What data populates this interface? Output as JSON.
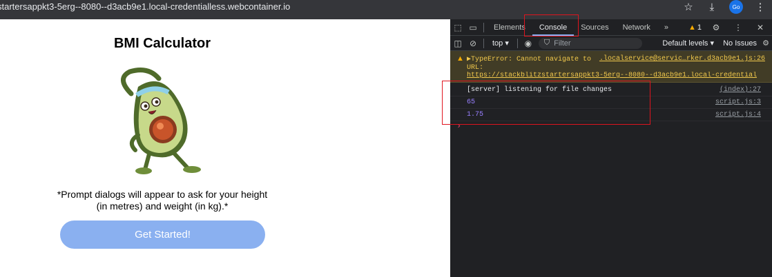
{
  "browser": {
    "url_prefix": "",
    "url": "startersappkt3-5erg--8080--d3acb9e1.local-credentialless.webcontainer.io",
    "icons": [
      "star-icon",
      "download-icon",
      "profile-icon",
      "more-icon"
    ],
    "profile_label": "Go"
  },
  "app": {
    "title": "BMI Calculator",
    "note": "*Prompt dialogs will appear to ask for your height (in metres) and weight (in kg).*",
    "cta_label": "Get Started!",
    "cta_color": "#8ab0f0"
  },
  "devtools": {
    "tabs": [
      "Elements",
      "Console",
      "Sources",
      "Network"
    ],
    "active_tab": "Console",
    "more_tabs": "»",
    "warning_count": "1",
    "context": "top",
    "filter_placeholder": "Filter",
    "levels_label": "Default levels ▾",
    "issues_label": "No Issues",
    "messages": {
      "error": {
        "text": "▶TypeError: Cannot navigate to",
        "source": ".localservice@servic…rker.d3acb9e1.js:26",
        "url_label": "URL:",
        "url": "https://stackblitzstartersappkt3-5erg--8080--d3acb9e1.local-credentialless…"
      },
      "logs": [
        {
          "text": "[server] listening for file changes",
          "source": "(index):27"
        },
        {
          "text": "65",
          "source": "script.js:3"
        },
        {
          "text": "1.75",
          "source": "script.js:4"
        }
      ]
    },
    "prompt": "›"
  }
}
